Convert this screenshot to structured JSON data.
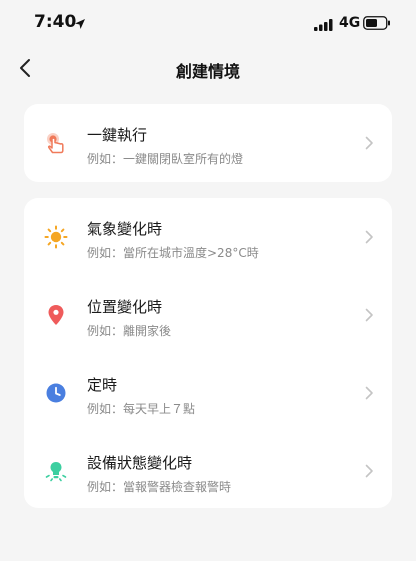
{
  "status_bar": {
    "time": "7:40",
    "network": "4G"
  },
  "nav": {
    "title": "創建情境"
  },
  "quick_action": {
    "title": "一鍵執行",
    "subtitle": "例如：一鍵關閉臥室所有的燈",
    "icon": "tap-hand-icon",
    "icon_color": "#f07a5a"
  },
  "conditions": [
    {
      "title": "氣象變化時",
      "subtitle": "例如：當所在城市溫度>28°C時",
      "icon": "sun-icon",
      "icon_color": "#f5a623"
    },
    {
      "title": "位置變化時",
      "subtitle": "例如：離開家後",
      "icon": "location-pin-icon",
      "icon_color": "#ef5b5b"
    },
    {
      "title": "定時",
      "subtitle": "例如：每天早上７點",
      "icon": "clock-icon",
      "icon_color": "#4a7fe0"
    },
    {
      "title": "設備狀態變化時",
      "subtitle": "例如：當報警器檢查報警時",
      "icon": "device-bulb-icon",
      "icon_color": "#3ccfa0"
    }
  ]
}
